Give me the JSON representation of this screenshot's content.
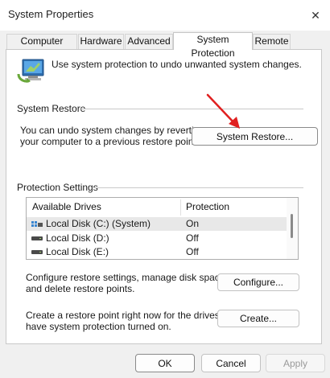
{
  "window": {
    "title": "System Properties",
    "close_glyph": "✕"
  },
  "tabs": [
    {
      "label": "Computer Name",
      "active": false
    },
    {
      "label": "Hardware",
      "active": false
    },
    {
      "label": "Advanced",
      "active": false
    },
    {
      "label": "System Protection",
      "active": true
    },
    {
      "label": "Remote",
      "active": false
    }
  ],
  "intro": {
    "icon": "system-protection-icon",
    "text": "Use system protection to undo unwanted system changes."
  },
  "system_restore": {
    "group_label": "System Restore",
    "description_line1": "You can undo system changes by reverting",
    "description_line2": "your computer to a previous restore point.",
    "button_label": "System Restore..."
  },
  "protection_settings": {
    "group_label": "Protection Settings",
    "columns": [
      "Available Drives",
      "Protection"
    ],
    "drives": [
      {
        "name": "Local Disk (C:) (System)",
        "protection": "On",
        "icon": "system-drive-icon",
        "selected": true
      },
      {
        "name": "Local Disk (D:)",
        "protection": "Off",
        "icon": "disk-drive-icon",
        "selected": false
      },
      {
        "name": "Local Disk (E:)",
        "protection": "Off",
        "icon": "disk-drive-icon",
        "selected": false
      }
    ],
    "configure_line1": "Configure restore settings, manage disk space,",
    "configure_line2": "and delete restore points.",
    "configure_button": "Configure...",
    "create_line1": "Create a restore point right now for the drives that",
    "create_line2": "have system protection turned on.",
    "create_button": "Create..."
  },
  "footer": {
    "ok": "OK",
    "cancel": "Cancel",
    "apply": "Apply"
  },
  "colors": {
    "annotation_arrow": "#e02020",
    "selected_row": "#e8e8e8",
    "window_bg": "#f0f0f0"
  }
}
